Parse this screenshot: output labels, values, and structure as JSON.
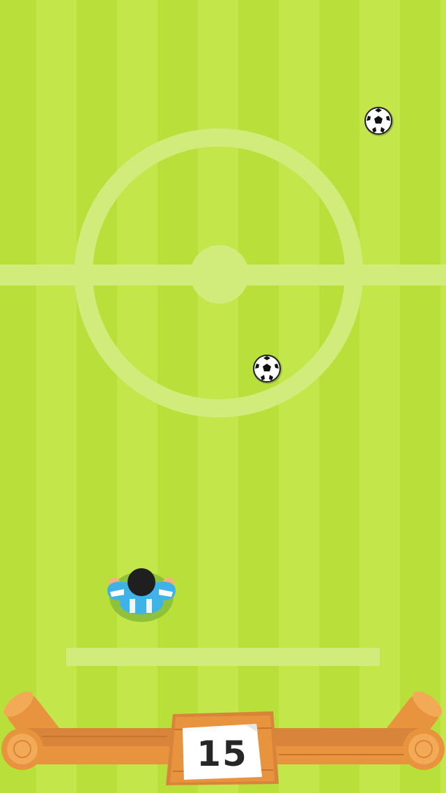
{
  "game": {
    "score": "15"
  },
  "field": {
    "base_color": "#b9e03a",
    "stripe_color": "#c3e64a",
    "line_color": "#d2ec7c",
    "stripe_count": 6
  },
  "balls": [
    {
      "name": "soccer-ball-top"
    },
    {
      "name": "soccer-ball-center"
    }
  ],
  "player": {
    "jersey_color": "#3fb3e8",
    "jersey_stripe": "#ffffff",
    "hair_color": "#1f1f1f",
    "shadow_color": "#8fc23a"
  },
  "fence": {
    "wood_color": "#e8943f",
    "wood_dark": "#c8732a",
    "card_color": "#ffffff"
  }
}
